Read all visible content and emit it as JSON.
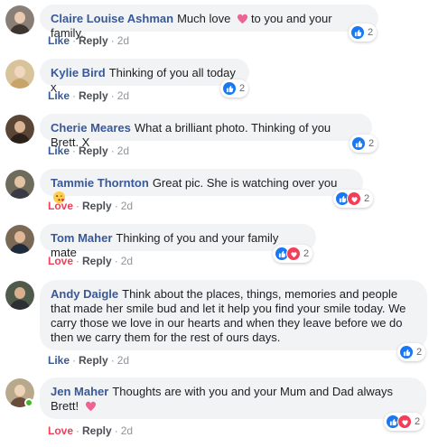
{
  "colors": {
    "like_blue": "#1877f2",
    "love_red": "#f33e58",
    "link": "#385898",
    "bubble": "#f2f3f5"
  },
  "reply_label": "Reply",
  "separator": "·",
  "comments": [
    {
      "author": "Claire Louise Ashman",
      "text_before": "Much love",
      "emoji": "heart-emoji",
      "text_after": "to you and your family.",
      "reaction": "Like",
      "time": "2d",
      "reactions": [
        "like"
      ],
      "count": "2"
    },
    {
      "author": "Kylie Bird",
      "text_before": "Thinking of you all today x",
      "reaction": "Like",
      "time": "2d",
      "reactions": [
        "like"
      ],
      "count": "2"
    },
    {
      "author": "Cherie Meares",
      "text_before": "What a brilliant photo. Thinking of you Brett. X",
      "reaction": "Like",
      "time": "2d",
      "reactions": [
        "like"
      ],
      "count": "2"
    },
    {
      "author": "Tammie Thornton",
      "text_before": "Great pic. She is watching over you",
      "emoji": "kissing-face-emoji",
      "reaction": "Love",
      "time": "2d",
      "reactions": [
        "like",
        "love"
      ],
      "count": "2"
    },
    {
      "author": "Tom Maher",
      "text_before": "Thinking of you and your family mate",
      "reaction": "Love",
      "time": "2d",
      "reactions": [
        "like",
        "love"
      ],
      "count": "2"
    },
    {
      "author": "Andy Daigle",
      "text_before": "Think about the places, things, memories and people that made her smile bud and let it help you find your smile today. We carry those we love in our hearts and when they leave before we do then we carry them for the rest of ours days.",
      "reaction": "Like",
      "time": "2d",
      "reactions": [
        "like"
      ],
      "count": "2"
    },
    {
      "author": "Jen Maher",
      "text_before": "Thoughts are with you and your Mum and Dad always Brett!",
      "emoji": "heart-emoji",
      "reaction": "Love",
      "time": "2d",
      "reactions": [
        "like",
        "love"
      ],
      "count": "2",
      "online": true
    }
  ]
}
